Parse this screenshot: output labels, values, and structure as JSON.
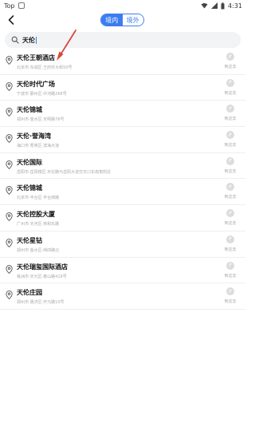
{
  "status_bar": {
    "carrier_label": "Top",
    "time": "4:31"
  },
  "header": {
    "tabs": [
      {
        "label": "境内",
        "active": true
      },
      {
        "label": "境外",
        "active": false
      }
    ]
  },
  "search": {
    "value": "天伦"
  },
  "results": [
    {
      "name": "天伦王朝酒店",
      "address": "北京市·东城区·王府井大街50号",
      "action_label": "到这去"
    },
    {
      "name": "天伦时代广场",
      "address": "宁波市·鄞州区·中河路268号",
      "action_label": "到这去"
    },
    {
      "name": "天伦锦城",
      "address": "郑州市·金水区·天明路76号",
      "action_label": "到这去"
    },
    {
      "name": "天伦·誉海湾",
      "address": "海口市·秀英区·滨海大道",
      "action_label": "到这去"
    },
    {
      "name": "天伦国际",
      "address": "岳阳市·岳阳楼区·天伦路与岳阳大道交叉口东南角附近",
      "action_label": "到这去"
    },
    {
      "name": "天伦锦城",
      "address": "北京市·丰台区·丰台南路",
      "action_label": "到这去"
    },
    {
      "name": "天伦控股大厦",
      "address": "广州市·天河区·林和东路",
      "action_label": "到这去"
    },
    {
      "name": "天伦星钻",
      "address": "郑州市·金水区·纬四路北",
      "action_label": "到这去"
    },
    {
      "name": "天伦瑞玺国际酒店",
      "address": "株洲市·天元区·泰山路419号",
      "action_label": "到这去"
    },
    {
      "name": "天伦庄园",
      "address": "郑州市·惠济区·开元路10号",
      "action_label": "到这去"
    }
  ],
  "colors": {
    "accent": "#3b7cf0",
    "annotation_arrow": "#d9463b"
  }
}
